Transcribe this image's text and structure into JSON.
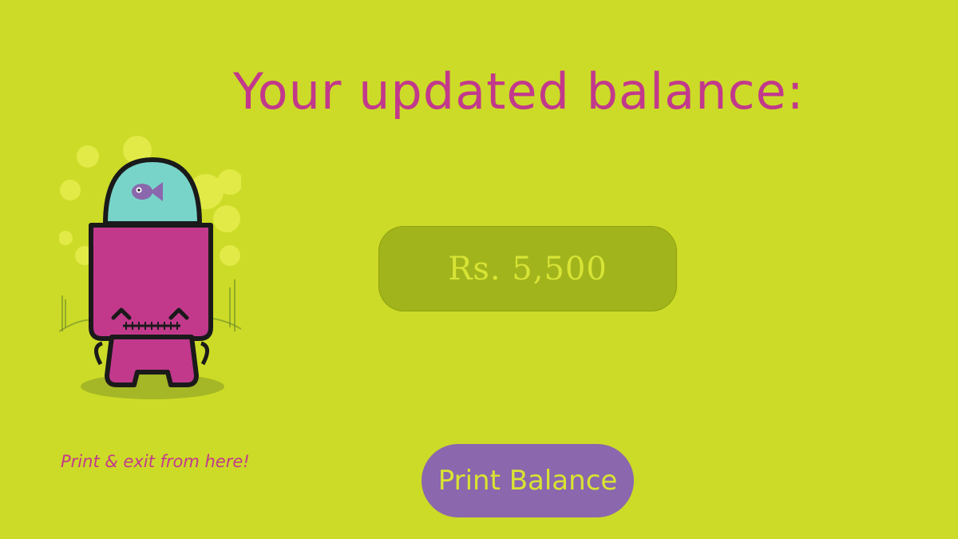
{
  "colors": {
    "background": "#CCDB27",
    "title_text": "#C2398C",
    "hint_text": "#C2398C",
    "balance_box_bg": "#A2B41C",
    "balance_text": "#D7E436",
    "print_button_bg": "#8B67AD",
    "print_button_text": "#D8E431"
  },
  "screen": {
    "title": "Your updated balance:",
    "balance": "Rs. 5,500",
    "hint": "Print & exit from here!",
    "print_button_label": "Print Balance",
    "mascot_icon": "pink-robot-fishbowl-mascot"
  }
}
